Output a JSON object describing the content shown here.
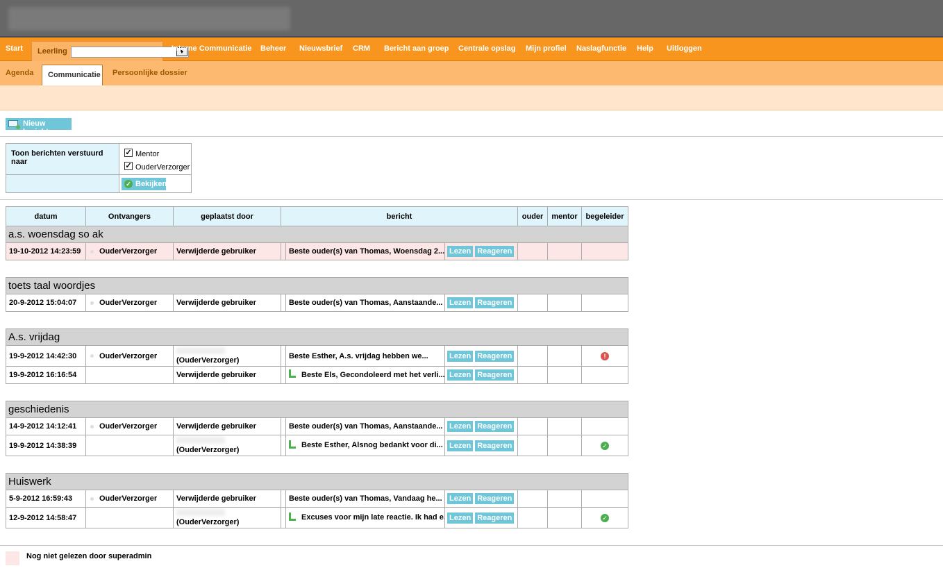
{
  "nav": {
    "start": "Start",
    "leerling_label": "Leerling",
    "items": [
      "Interne Communicatie",
      "Beheer",
      "Nieuwsbrief",
      "CRM",
      "Bericht aan groep",
      "Centrale opslag",
      "Mijn profiel",
      "Naslagfunctie",
      "Help",
      "Uitloggen"
    ]
  },
  "subnav": {
    "agenda": "Agenda",
    "communicatie": "Communicatie",
    "dossier": "Persoonlijke dossier"
  },
  "toolbar": {
    "new_message": "Nieuw bericht"
  },
  "filter": {
    "label": "Toon berichten verstuurd naar",
    "opt_mentor": "Mentor",
    "opt_ouder": "OuderVerzorger",
    "view_button": "Bekijken"
  },
  "table": {
    "headers": [
      "datum",
      "Ontvangers",
      "geplaatst door",
      "bericht",
      "ouder",
      "mentor",
      "begeleider"
    ],
    "read_label": "Lezen",
    "reply_label": "Reageren",
    "groups": [
      {
        "title": "a.s. woensdag so ak",
        "rows": [
          {
            "date": "19-10-2012 14:23:59",
            "recipient": "OuderVerzorger",
            "by": "Verwijderde gebruiker",
            "message": "Beste ouder(s) van Thomas, Woensdag 2...",
            "unread": true
          }
        ]
      },
      {
        "title": "toets taal woordjes",
        "rows": [
          {
            "date": "20-9-2012 15:04:07",
            "recipient": "OuderVerzorger",
            "by": "Verwijderde gebruiker",
            "message": "Beste ouder(s) van Thomas, Aanstaande..."
          }
        ]
      },
      {
        "title": "A.s. vrijdag",
        "rows": [
          {
            "date": "19-9-2012 14:42:30",
            "recipient": "OuderVerzorger",
            "by_role": "(OuderVerzorger)",
            "message": "Beste Esther, A.s. vrijdag hebben we...",
            "status": "warn"
          },
          {
            "date": "19-9-2012 16:16:54",
            "by": "Verwijderde gebruiker",
            "message": "Beste Els, Gecondoleerd met het verli...",
            "reply": true
          }
        ]
      },
      {
        "title": "geschiedenis",
        "rows": [
          {
            "date": "14-9-2012 14:12:41",
            "recipient": "OuderVerzorger",
            "by": "Verwijderde gebruiker",
            "message": "Beste ouder(s) van Thomas, Aanstaande..."
          },
          {
            "date": "19-9-2012 14:38:39",
            "by_role": "(OuderVerzorger)",
            "message": "Beste Esther, Alsnog bedankt voor di...",
            "reply": true,
            "status": "ok"
          }
        ]
      },
      {
        "title": "Huiswerk",
        "rows": [
          {
            "date": "5-9-2012 16:59:43",
            "recipient": "OuderVerzorger",
            "by": "Verwijderde gebruiker",
            "message": "Beste ouder(s) van Thomas, Vandaag he..."
          },
          {
            "date": "12-9-2012 14:58:47",
            "by_role": "(OuderVerzorger)",
            "message": "Excuses voor mijn late reactie. Ik had e...",
            "reply": true,
            "status": "ok"
          }
        ]
      }
    ]
  },
  "legend": {
    "unread": "Nog niet gelezen door superadmin"
  }
}
